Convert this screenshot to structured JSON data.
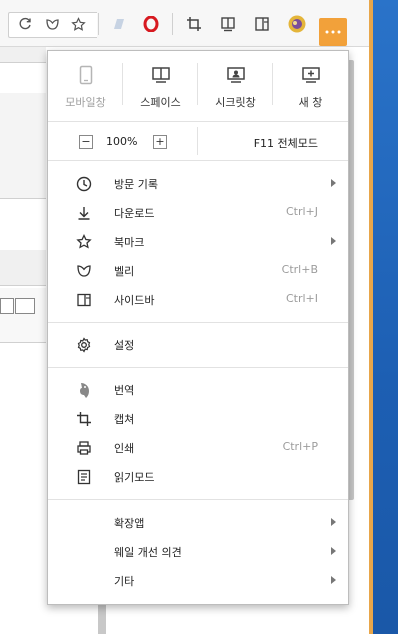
{
  "menu": {
    "quick": [
      {
        "label": "모바일창",
        "icon": "mobile-icon",
        "dim": true
      },
      {
        "label": "스페이스",
        "icon": "space-icon",
        "dim": false
      },
      {
        "label": "시크릿창",
        "icon": "secret-window-icon",
        "dim": false
      },
      {
        "label": "새 창",
        "icon": "new-window-icon",
        "dim": false
      }
    ],
    "zoom": {
      "minus": "−",
      "value": "100%",
      "plus": "+",
      "fullscreen": "F11 전체모드"
    },
    "items": [
      {
        "label": "방문 기록",
        "shortcut": "",
        "submenu": true,
        "icon": "clock-icon"
      },
      {
        "label": "다운로드",
        "shortcut": "Ctrl+J",
        "submenu": false,
        "icon": "download-icon"
      },
      {
        "label": "북마크",
        "shortcut": "",
        "submenu": true,
        "icon": "star-icon"
      },
      {
        "label": "벨리",
        "shortcut": "Ctrl+B",
        "submenu": false,
        "icon": "valley-icon"
      },
      {
        "label": "사이드바",
        "shortcut": "Ctrl+I",
        "submenu": false,
        "icon": "sidebar-icon"
      },
      {
        "label": "설정",
        "shortcut": "",
        "submenu": false,
        "icon": "gear-icon"
      },
      {
        "label": "번역",
        "shortcut": "",
        "submenu": false,
        "icon": "translate-icon"
      },
      {
        "label": "캡쳐",
        "shortcut": "",
        "submenu": false,
        "icon": "capture-icon"
      },
      {
        "label": "인쇄",
        "shortcut": "Ctrl+P",
        "submenu": false,
        "icon": "print-icon"
      },
      {
        "label": "읽기모드",
        "shortcut": "",
        "submenu": false,
        "icon": "reading-mode-icon"
      },
      {
        "label": "확장앱",
        "shortcut": "",
        "submenu": true,
        "icon": ""
      },
      {
        "label": "웨일 개선 의견",
        "shortcut": "",
        "submenu": true,
        "icon": ""
      },
      {
        "label": "기타",
        "shortcut": "",
        "submenu": true,
        "icon": ""
      }
    ]
  },
  "colors": {
    "menu_button": "#f2a13a",
    "desktop": "#1d5fb3"
  }
}
